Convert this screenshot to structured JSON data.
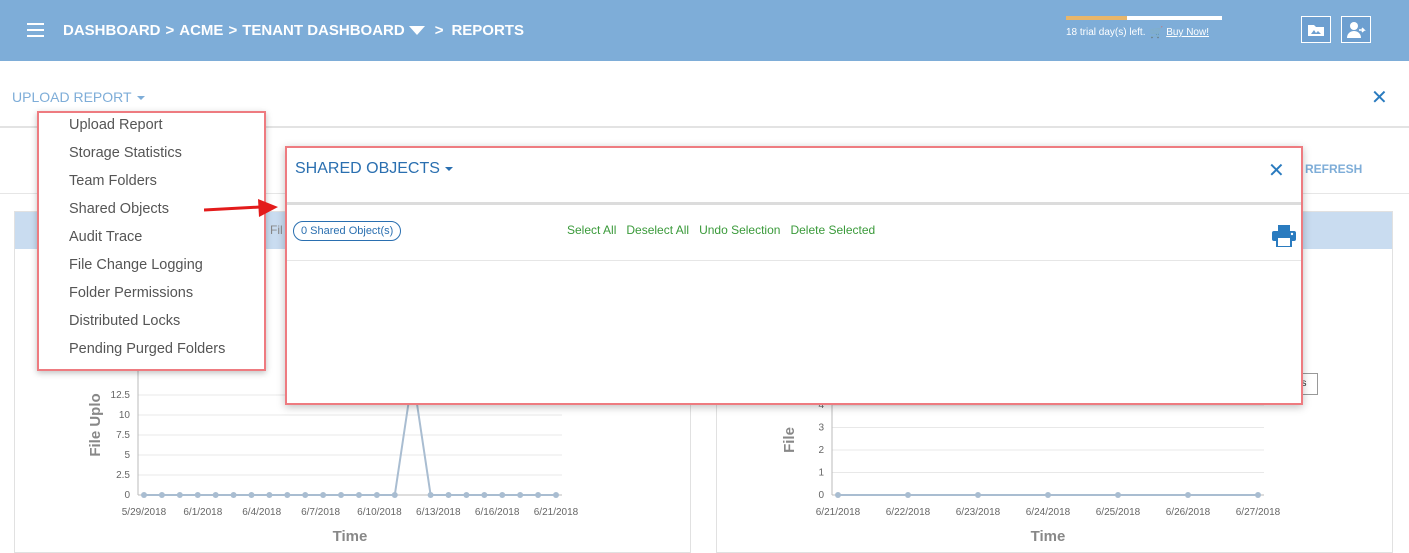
{
  "header": {
    "breadcrumb_1": "DASHBOARD",
    "breadcrumb_sep": ">",
    "breadcrumb_2": "ACME",
    "breadcrumb_3": "TENANT DASHBOARD",
    "breadcrumb_4": "REPORTS",
    "trial_text": "18 trial day(s) left.",
    "trial_progress": 0.39,
    "buy_now": "Buy Now!",
    "icons": [
      "menu-icon",
      "cart-icon",
      "folder-picture-icon",
      "user-switch-icon"
    ]
  },
  "subheader": {
    "report_selector": "UPLOAD REPORT",
    "refresh_label": "REFRESH"
  },
  "report_menu": {
    "items": [
      "Upload Report",
      "Storage Statistics",
      "Team Folders",
      "Shared Objects",
      "Audit Trace",
      "File Change Logging",
      "Folder Permissions",
      "Distributed Locks",
      "Pending Purged Folders"
    ]
  },
  "modal": {
    "title": "SHARED OBJECTS",
    "count_badge": "0 Shared Object(s)",
    "select_all": "Select All",
    "deselect_all": "Deselect All",
    "undo_selection": "Undo Selection",
    "delete_selected": "Delete Selected",
    "icons": [
      "close-icon",
      "print-icon"
    ]
  },
  "background_legend_fragment": "es",
  "background_title_fragment": "Fil",
  "chart_data": [
    {
      "type": "line",
      "ylabel": "File Uplo",
      "xlabel": "Time",
      "y_ticks": [
        "0",
        "2.5",
        "5",
        "7.5",
        "10",
        "12.5"
      ],
      "x_tick_labels": [
        "5/29/2018",
        "6/1/2018",
        "6/4/2018",
        "6/7/2018",
        "6/10/2018",
        "6/13/2018",
        "6/16/2018",
        "6/21/2018"
      ],
      "ylim": [
        0,
        15
      ],
      "values": [
        0,
        0,
        0,
        0,
        0,
        0,
        0,
        0,
        0,
        0,
        0,
        0,
        0,
        0,
        0,
        15,
        0,
        0,
        0,
        0,
        0,
        0,
        0,
        0
      ],
      "color": "#a9bdd1"
    },
    {
      "type": "line",
      "ylabel": "File",
      "xlabel": "Time",
      "y_ticks": [
        "0",
        "1",
        "2",
        "3",
        "4"
      ],
      "x_tick_labels": [
        "6/21/2018",
        "6/22/2018",
        "6/23/2018",
        "6/24/2018",
        "6/25/2018",
        "6/26/2018",
        "6/27/2018"
      ],
      "ylim": [
        0,
        4
      ],
      "values": [
        0,
        0,
        0,
        0,
        0,
        0,
        0
      ],
      "color": "#a9bdd1"
    }
  ]
}
